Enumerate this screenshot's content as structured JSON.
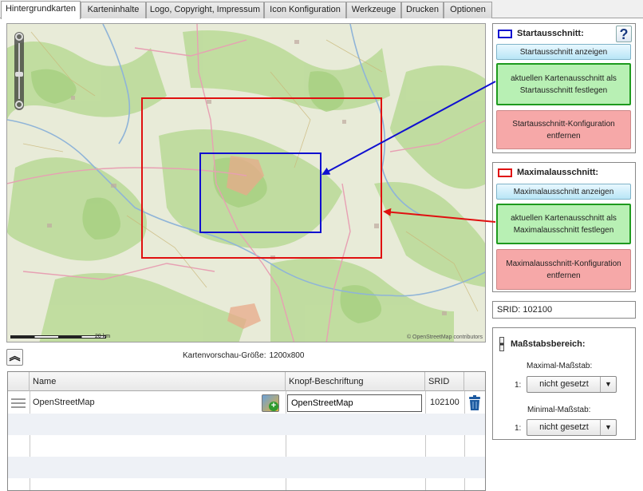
{
  "tabs": [
    {
      "label": "Hintergrundkarten",
      "active": true
    },
    {
      "label": "Karteninhalte",
      "active": false
    },
    {
      "label": "Logo, Copyright, Impressum",
      "active": false
    },
    {
      "label": "Icon Konfiguration",
      "active": false
    },
    {
      "label": "Werkzeuge",
      "active": false
    },
    {
      "label": "Drucken",
      "active": false
    },
    {
      "label": "Optionen",
      "active": false
    }
  ],
  "map": {
    "scale_label": "20 km",
    "attribution": "© OpenStreetMap contributors"
  },
  "preview": {
    "label": "Kartenvorschau-Größe:",
    "size": "1200x800"
  },
  "table": {
    "columns": [
      "Name",
      "Knopf-Beschriftung",
      "SRID"
    ],
    "rows": [
      {
        "name": "OpenStreetMap",
        "button_label": "OpenStreetMap",
        "srid": "102100"
      }
    ]
  },
  "start_panel": {
    "title": "Startausschnitt:",
    "color": "#1010d0",
    "help": "?",
    "show_button": "Startausschnitt anzeigen",
    "set_button": "aktuellen Kartenausschnitt als Startausschnitt festlegen",
    "remove_button": "Startausschnitt-Konfiguration entfernen"
  },
  "max_panel": {
    "title": "Maximalausschnitt:",
    "color": "#e01010",
    "show_button": "Maximalausschnitt anzeigen",
    "set_button": "aktuellen Kartenausschnitt als Maximalausschnitt festlegen",
    "remove_button": "Maximalausschnitt-Konfiguration entfernen"
  },
  "srid_info": "SRID: 102100",
  "scale_panel": {
    "title": "Maßstabsbereich:",
    "max_label": "Maximal-Maßstab:",
    "min_label": "Minimal-Maßstab:",
    "prefix": "1:",
    "max_value": "nicht gesetzt",
    "min_value": "nicht gesetzt"
  }
}
